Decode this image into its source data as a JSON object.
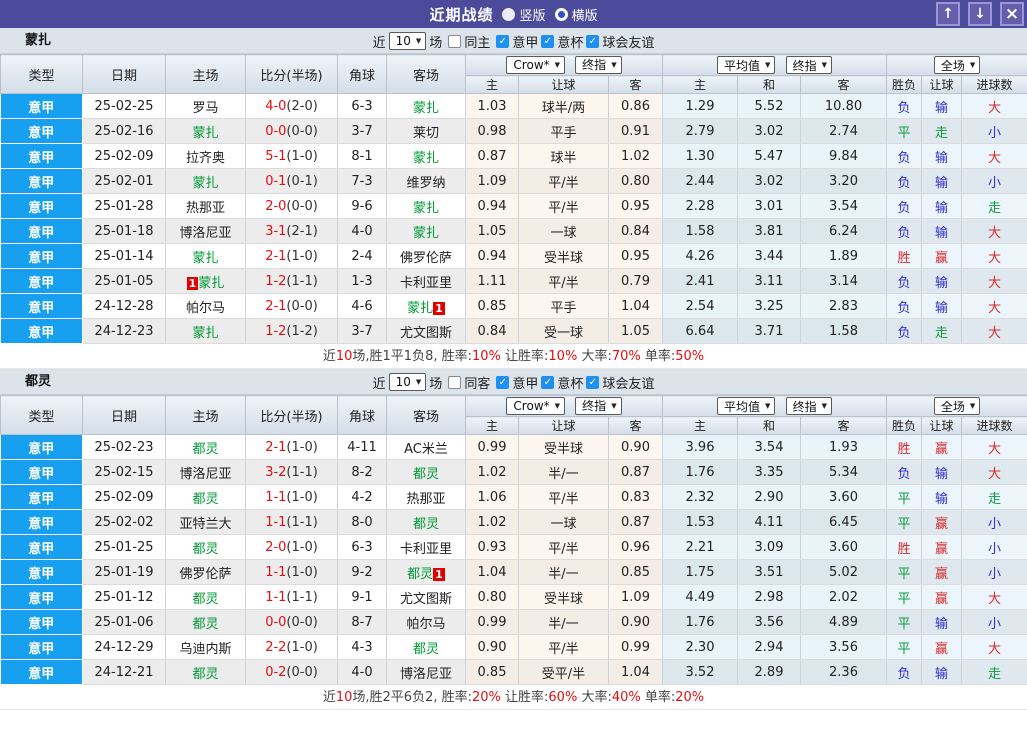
{
  "titlebar": {
    "title": "近期战绩",
    "radio_vertical": "竖版",
    "radio_horizontal": "横版",
    "up_glyph": "↑",
    "down_glyph": "↓",
    "close_glyph": "×",
    "bar_color": "#4b4a9b"
  },
  "filter": {
    "prefix": "近",
    "count": "10",
    "suffix": "场",
    "leagues": [
      "意甲",
      "意杯",
      "球会友谊"
    ]
  },
  "header": {
    "cols": [
      "类型",
      "日期",
      "主场",
      "比分(半场)",
      "角球",
      "客场"
    ],
    "selects": {
      "source": "Crow*",
      "final1": "终指",
      "avg": "平均值",
      "final2": "终指",
      "scope": "全场"
    },
    "sub_cols": [
      "主",
      "让球",
      "客",
      "主",
      "和",
      "客",
      "胜负",
      "让球",
      "进球数"
    ]
  },
  "colors": {
    "league_cell": "#18a0f0",
    "win_text": "#d92b2b",
    "lose_text": "#2f2fd0",
    "draw_text": "#0f9a3c",
    "team_highlight": "#009933",
    "score_red": "#e01010"
  },
  "sections": [
    {
      "team": "蒙扎",
      "same_label": "同主",
      "rows": [
        [
          "意甲",
          "25-02-25",
          "罗马",
          "",
          "4-0",
          "(2-0)",
          "6-3",
          "蒙扎",
          "",
          "1.03",
          "球半/两",
          "0.86",
          "1.29",
          "5.52",
          "10.80",
          "负",
          "输",
          "大"
        ],
        [
          "意甲",
          "25-02-16",
          "蒙扎",
          "",
          "0-0",
          "(0-0)",
          "3-7",
          "莱切",
          "",
          "0.98",
          "平手",
          "0.91",
          "2.79",
          "3.02",
          "2.74",
          "平",
          "走",
          "小"
        ],
        [
          "意甲",
          "25-02-09",
          "拉齐奥",
          "",
          "5-1",
          "(1-0)",
          "8-1",
          "蒙扎",
          "",
          "0.87",
          "球半",
          "1.02",
          "1.30",
          "5.47",
          "9.84",
          "负",
          "输",
          "大"
        ],
        [
          "意甲",
          "25-02-01",
          "蒙扎",
          "",
          "0-1",
          "(0-1)",
          "7-3",
          "维罗纳",
          "",
          "1.09",
          "平/半",
          "0.80",
          "2.44",
          "3.02",
          "3.20",
          "负",
          "输",
          "小"
        ],
        [
          "意甲",
          "25-01-28",
          "热那亚",
          "",
          "2-0",
          "(0-0)",
          "9-6",
          "蒙扎",
          "",
          "0.94",
          "平/半",
          "0.95",
          "2.28",
          "3.01",
          "3.54",
          "负",
          "输",
          "走"
        ],
        [
          "意甲",
          "25-01-18",
          "博洛尼亚",
          "",
          "3-1",
          "(2-1)",
          "4-0",
          "蒙扎",
          "",
          "1.05",
          "一球",
          "0.84",
          "1.58",
          "3.81",
          "6.24",
          "负",
          "输",
          "大"
        ],
        [
          "意甲",
          "25-01-14",
          "蒙扎",
          "",
          "2-1",
          "(1-0)",
          "2-4",
          "佛罗伦萨",
          "",
          "0.94",
          "受半球",
          "0.95",
          "4.26",
          "3.44",
          "1.89",
          "胜",
          "赢",
          "大"
        ],
        [
          "意甲",
          "25-01-05",
          "蒙扎",
          "1",
          "1-2",
          "(1-1)",
          "1-3",
          "卡利亚里",
          "",
          "1.11",
          "平/半",
          "0.79",
          "2.41",
          "3.11",
          "3.14",
          "负",
          "输",
          "大"
        ],
        [
          "意甲",
          "24-12-28",
          "帕尔马",
          "",
          "2-1",
          "(0-0)",
          "4-6",
          "蒙扎",
          "1",
          "0.85",
          "平手",
          "1.04",
          "2.54",
          "3.25",
          "2.83",
          "负",
          "输",
          "大"
        ],
        [
          "意甲",
          "24-12-23",
          "蒙扎",
          "",
          "1-2",
          "(1-2)",
          "3-7",
          "尤文图斯",
          "",
          "0.84",
          "受一球",
          "1.05",
          "6.64",
          "3.71",
          "1.58",
          "负",
          "走",
          "大"
        ]
      ],
      "summary": [
        [
          "近",
          "d"
        ],
        [
          "10",
          "r"
        ],
        [
          "场,胜1平1负8, 胜率:",
          "d"
        ],
        [
          "10%",
          "r"
        ],
        [
          " 让胜率:",
          "d"
        ],
        [
          "10%",
          "r"
        ],
        [
          " 大率:",
          "d"
        ],
        [
          "70%",
          "r"
        ],
        [
          " 单率:",
          "d"
        ],
        [
          "50%",
          "r"
        ]
      ]
    },
    {
      "team": "都灵",
      "same_label": "同客",
      "rows": [
        [
          "意甲",
          "25-02-23",
          "都灵",
          "",
          "2-1",
          "(1-0)",
          "4-11",
          "AC米兰",
          "",
          "0.99",
          "受半球",
          "0.90",
          "3.96",
          "3.54",
          "1.93",
          "胜",
          "赢",
          "大"
        ],
        [
          "意甲",
          "25-02-15",
          "博洛尼亚",
          "",
          "3-2",
          "(1-1)",
          "8-2",
          "都灵",
          "",
          "1.02",
          "半/一",
          "0.87",
          "1.76",
          "3.35",
          "5.34",
          "负",
          "输",
          "大"
        ],
        [
          "意甲",
          "25-02-09",
          "都灵",
          "",
          "1-1",
          "(1-0)",
          "4-2",
          "热那亚",
          "",
          "1.06",
          "平/半",
          "0.83",
          "2.32",
          "2.90",
          "3.60",
          "平",
          "输",
          "走"
        ],
        [
          "意甲",
          "25-02-02",
          "亚特兰大",
          "",
          "1-1",
          "(1-1)",
          "8-0",
          "都灵",
          "",
          "1.02",
          "一球",
          "0.87",
          "1.53",
          "4.11",
          "6.45",
          "平",
          "赢",
          "小"
        ],
        [
          "意甲",
          "25-01-25",
          "都灵",
          "",
          "2-0",
          "(1-0)",
          "6-3",
          "卡利亚里",
          "",
          "0.93",
          "平/半",
          "0.96",
          "2.21",
          "3.09",
          "3.60",
          "胜",
          "赢",
          "小"
        ],
        [
          "意甲",
          "25-01-19",
          "佛罗伦萨",
          "",
          "1-1",
          "(1-0)",
          "9-2",
          "都灵",
          "1",
          "1.04",
          "半/一",
          "0.85",
          "1.75",
          "3.51",
          "5.02",
          "平",
          "赢",
          "小"
        ],
        [
          "意甲",
          "25-01-12",
          "都灵",
          "",
          "1-1",
          "(1-1)",
          "9-1",
          "尤文图斯",
          "",
          "0.80",
          "受半球",
          "1.09",
          "4.49",
          "2.98",
          "2.02",
          "平",
          "赢",
          "大"
        ],
        [
          "意甲",
          "25-01-06",
          "都灵",
          "",
          "0-0",
          "(0-0)",
          "8-7",
          "帕尔马",
          "",
          "0.99",
          "半/一",
          "0.90",
          "1.76",
          "3.56",
          "4.89",
          "平",
          "输",
          "小"
        ],
        [
          "意甲",
          "24-12-29",
          "乌迪内斯",
          "",
          "2-2",
          "(1-0)",
          "4-3",
          "都灵",
          "",
          "0.90",
          "平/半",
          "0.99",
          "2.30",
          "2.94",
          "3.56",
          "平",
          "赢",
          "大"
        ],
        [
          "意甲",
          "24-12-21",
          "都灵",
          "",
          "0-2",
          "(0-0)",
          "4-0",
          "博洛尼亚",
          "",
          "0.85",
          "受平/半",
          "1.04",
          "3.52",
          "2.89",
          "2.36",
          "负",
          "输",
          "走"
        ]
      ],
      "summary": [
        [
          "近",
          "d"
        ],
        [
          "10",
          "r"
        ],
        [
          "场,胜2平6负2, 胜率:",
          "d"
        ],
        [
          "20%",
          "r"
        ],
        [
          " 让胜率:",
          "d"
        ],
        [
          "60%",
          "r"
        ],
        [
          " 大率:",
          "d"
        ],
        [
          "40%",
          "r"
        ],
        [
          " 单率:",
          "d"
        ],
        [
          "20%",
          "r"
        ]
      ]
    }
  ]
}
